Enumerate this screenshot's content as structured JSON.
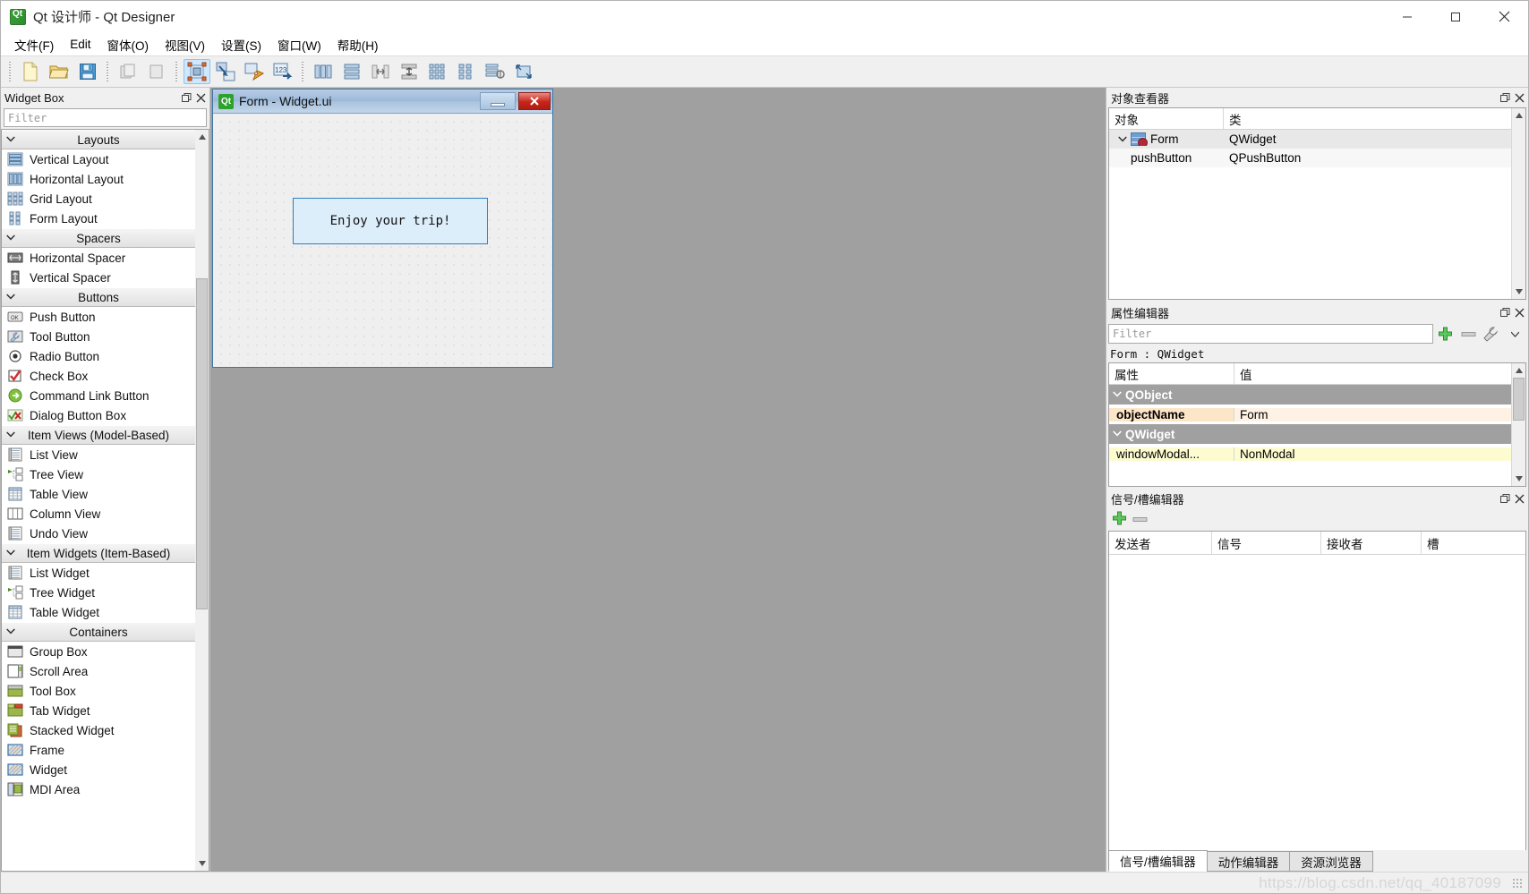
{
  "window": {
    "title": "Qt 设计师 - Qt Designer",
    "icon": "qt-logo-icon",
    "minimize": "─",
    "maximize": "□",
    "close": "✕"
  },
  "menubar": {
    "items": [
      {
        "label": "文件(F)",
        "name": "menu-file"
      },
      {
        "label": "Edit",
        "name": "menu-edit"
      },
      {
        "label": "窗体(O)",
        "name": "menu-form"
      },
      {
        "label": "视图(V)",
        "name": "menu-view"
      },
      {
        "label": "设置(S)",
        "name": "menu-settings"
      },
      {
        "label": "窗口(W)",
        "name": "menu-window"
      },
      {
        "label": "帮助(H)",
        "name": "menu-help"
      }
    ]
  },
  "toolbar": {
    "groups": [
      {
        "name": "file-group",
        "buttons": [
          {
            "name": "new-form-button",
            "icon": "new-document-icon",
            "active": false
          },
          {
            "name": "open-form-button",
            "icon": "open-folder-icon",
            "active": false
          },
          {
            "name": "save-form-button",
            "icon": "save-disk-icon",
            "active": false
          }
        ]
      },
      {
        "name": "edit-group",
        "buttons": [
          {
            "name": "undo-button",
            "icon": "undo-icon",
            "active": false
          },
          {
            "name": "redo-button",
            "icon": "redo-icon",
            "active": false
          }
        ]
      },
      {
        "name": "mode-group",
        "buttons": [
          {
            "name": "edit-widgets-button",
            "icon": "edit-widgets-icon",
            "active": true
          },
          {
            "name": "edit-signals-slots-button",
            "icon": "signals-slots-icon",
            "active": false
          },
          {
            "name": "edit-buddies-button",
            "icon": "buddies-icon",
            "active": false
          },
          {
            "name": "edit-tab-order-button",
            "icon": "tab-order-icon",
            "active": false
          }
        ]
      },
      {
        "name": "layout-group",
        "buttons": [
          {
            "name": "layout-horizontally-button",
            "icon": "layout-horizontal-icon",
            "active": false
          },
          {
            "name": "layout-vertically-button",
            "icon": "layout-vertical-icon",
            "active": false
          },
          {
            "name": "layout-splitter-h-button",
            "icon": "splitter-horizontal-icon",
            "active": false
          },
          {
            "name": "layout-splitter-v-button",
            "icon": "splitter-vertical-icon",
            "active": false
          },
          {
            "name": "layout-grid-button",
            "icon": "layout-grid-icon",
            "active": false
          },
          {
            "name": "layout-form-button",
            "icon": "layout-form-icon",
            "active": false
          },
          {
            "name": "break-layout-button",
            "icon": "break-layout-icon",
            "active": false
          },
          {
            "name": "adjust-size-button",
            "icon": "adjust-size-icon",
            "active": false
          }
        ]
      }
    ]
  },
  "widget_box": {
    "title": "Widget Box",
    "filter_placeholder": "Filter",
    "float_button": "❐",
    "close_button": "✕",
    "categories": [
      {
        "name": "Layouts",
        "expanded": true,
        "items": [
          {
            "label": "Vertical Layout",
            "icon": "vertical-layout-icon"
          },
          {
            "label": "Horizontal Layout",
            "icon": "horizontal-layout-icon"
          },
          {
            "label": "Grid Layout",
            "icon": "grid-layout-icon"
          },
          {
            "label": "Form Layout",
            "icon": "form-layout-icon"
          }
        ]
      },
      {
        "name": "Spacers",
        "expanded": true,
        "items": [
          {
            "label": "Horizontal Spacer",
            "icon": "horizontal-spacer-icon"
          },
          {
            "label": "Vertical Spacer",
            "icon": "vertical-spacer-icon"
          }
        ]
      },
      {
        "name": "Buttons",
        "expanded": true,
        "items": [
          {
            "label": "Push Button",
            "icon": "push-button-icon"
          },
          {
            "label": "Tool Button",
            "icon": "tool-button-icon"
          },
          {
            "label": "Radio Button",
            "icon": "radio-button-icon"
          },
          {
            "label": "Check Box",
            "icon": "check-box-icon"
          },
          {
            "label": "Command Link Button",
            "icon": "command-link-icon"
          },
          {
            "label": "Dialog Button Box",
            "icon": "dialog-button-box-icon"
          }
        ]
      },
      {
        "name": "Item Views (Model-Based)",
        "expanded": true,
        "items": [
          {
            "label": "List View",
            "icon": "list-view-icon"
          },
          {
            "label": "Tree View",
            "icon": "tree-view-icon"
          },
          {
            "label": "Table View",
            "icon": "table-view-icon"
          },
          {
            "label": "Column View",
            "icon": "column-view-icon"
          },
          {
            "label": "Undo View",
            "icon": "undo-view-icon"
          }
        ]
      },
      {
        "name": "Item Widgets (Item-Based)",
        "expanded": true,
        "items": [
          {
            "label": "List Widget",
            "icon": "list-widget-icon"
          },
          {
            "label": "Tree Widget",
            "icon": "tree-widget-icon"
          },
          {
            "label": "Table Widget",
            "icon": "table-widget-icon"
          }
        ]
      },
      {
        "name": "Containers",
        "expanded": true,
        "items": [
          {
            "label": "Group Box",
            "icon": "group-box-icon"
          },
          {
            "label": "Scroll Area",
            "icon": "scroll-area-icon"
          },
          {
            "label": "Tool Box",
            "icon": "tool-box-icon"
          },
          {
            "label": "Tab Widget",
            "icon": "tab-widget-icon"
          },
          {
            "label": "Stacked Widget",
            "icon": "stacked-widget-icon"
          },
          {
            "label": "Frame",
            "icon": "frame-icon"
          },
          {
            "label": "Widget",
            "icon": "widget-icon"
          },
          {
            "label": "MDI Area",
            "icon": "mdi-area-icon"
          }
        ]
      }
    ]
  },
  "form_window": {
    "title": "Form - Widget.ui",
    "icon": "qt-logo-icon",
    "minimize": "",
    "close": "✕",
    "button": {
      "text": "Enjoy your trip!",
      "selected": true
    }
  },
  "object_inspector": {
    "title": "对象查看器",
    "float_button": "❐",
    "close_button": "✕",
    "columns": [
      "对象",
      "类"
    ],
    "rows": [
      {
        "object": "Form",
        "class": "QWidget",
        "level": 0,
        "expanded": true,
        "selected": true,
        "icon": "form-node-icon"
      },
      {
        "object": "pushButton",
        "class": "QPushButton",
        "level": 1,
        "expanded": false,
        "selected": false,
        "icon": ""
      }
    ]
  },
  "property_editor": {
    "title": "属性编辑器",
    "float_button": "❐",
    "close_button": "✕",
    "filter_placeholder": "Filter",
    "add_icon": "add-plus-icon",
    "remove_icon": "remove-minus-icon",
    "config_icon": "wrench-icon",
    "object_label": "Form : QWidget",
    "columns": [
      "属性",
      "值"
    ],
    "rows": [
      {
        "type": "group",
        "name": "QObject",
        "value": "",
        "expanded": true
      },
      {
        "type": "prop-orange",
        "name": "objectName",
        "value": "Form"
      },
      {
        "type": "group",
        "name": "QWidget",
        "value": "",
        "expanded": true
      },
      {
        "type": "prop-yellow",
        "name": "windowModal...",
        "value": "NonModal"
      }
    ]
  },
  "signal_slot_editor": {
    "title": "信号/槽编辑器",
    "float_button": "❐",
    "close_button": "✕",
    "add_icon": "add-plus-icon",
    "remove_icon": "remove-minus-icon",
    "columns": [
      "发送者",
      "信号",
      "接收者",
      "槽"
    ],
    "rows": []
  },
  "bottom_tabs": {
    "items": [
      {
        "label": "信号/槽编辑器",
        "active": true,
        "name": "tab-signal-slot-editor"
      },
      {
        "label": "动作编辑器",
        "active": false,
        "name": "tab-action-editor"
      },
      {
        "label": "资源浏览器",
        "active": false,
        "name": "tab-resource-browser"
      }
    ]
  },
  "statusbar": {
    "watermark": "https://blog.csdn.net/qq_40187099"
  },
  "colors": {
    "accent": "#2f7fbf",
    "canvas_bg": "#a0a0a0",
    "panel_bg": "#f0f0f0",
    "selected_button_fill": "#ddeefb",
    "group_header": "#a0a0a0",
    "orange_prop": "#fde5c8",
    "yellow_prop": "#fdfbd0"
  }
}
